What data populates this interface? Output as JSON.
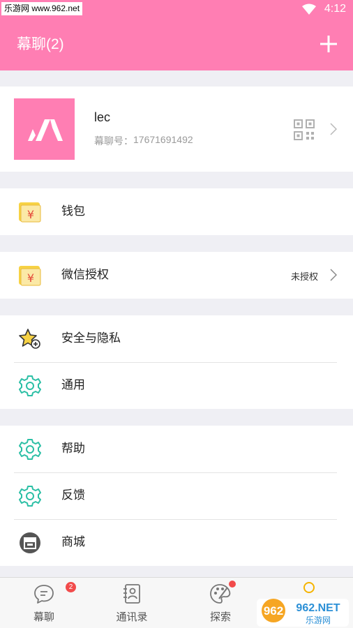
{
  "status_bar": {
    "watermark_text": "乐游网 www.962.net",
    "time": "4:12",
    "icons": [
      "wifi-icon",
      "signal-icon",
      "battery-icon"
    ]
  },
  "app_bar": {
    "title": "幕聊(2)",
    "add_icon": "plus-icon"
  },
  "profile": {
    "name": "lec",
    "id_label": "幕聊号：",
    "id_value": "17671691492",
    "avatar_icon": "app-logo-icon",
    "qr_icon": "qr-code-icon"
  },
  "menu": {
    "wallet": {
      "label": "钱包",
      "icon": "wallet-icon"
    },
    "wechat_auth": {
      "label": "微信授权",
      "status": "未授权",
      "icon": "wallet-icon"
    },
    "security": {
      "label": "安全与隐私",
      "icon": "star-icon"
    },
    "general": {
      "label": "通用",
      "icon": "gear-icon"
    },
    "help": {
      "label": "帮助",
      "icon": "gear-icon"
    },
    "feedback": {
      "label": "反馈",
      "icon": "gear-icon"
    },
    "shop": {
      "label": "商城",
      "icon": "store-icon"
    }
  },
  "bottom_nav": {
    "items": [
      {
        "label": "幕聊",
        "icon": "chat-bubble-icon",
        "badge": "2"
      },
      {
        "label": "通讯录",
        "icon": "contacts-book-icon"
      },
      {
        "label": "探索",
        "icon": "palette-icon"
      },
      {
        "label": "",
        "icon": "profile-icon"
      }
    ]
  },
  "watermark": {
    "text": "962.NET",
    "subtext": "乐游网"
  },
  "colors": {
    "brand_pink": "#ff7eb3",
    "teal_icon": "#2bbfa5",
    "badge_red": "#f24b4b",
    "wallet_yellow": "#f7d244"
  }
}
